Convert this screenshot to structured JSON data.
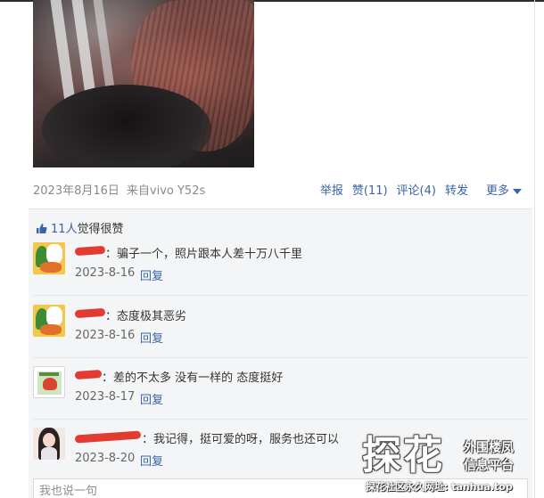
{
  "post": {
    "date": "2023年8月16日",
    "source": "来自vivo Y52s",
    "actions": {
      "report": "举报",
      "like": "赞(11)",
      "comment": "评论(4)",
      "forward": "转发",
      "more": "更多"
    }
  },
  "likes": {
    "count_text": "11人",
    "suffix": "觉得很赞"
  },
  "comments": [
    {
      "text": "：骗子一个，照片跟本人差十万八千里",
      "date": "2023-8-16",
      "reply": "回复"
    },
    {
      "text": "：态度极其恶劣",
      "date": "2023-8-16",
      "reply": "回复"
    },
    {
      "text": "：差的不太多 没有一样的 态度挺好",
      "date": "2023-8-17",
      "reply": "回复"
    },
    {
      "text": "：我记得，挺可爱的呀，服务也还可以",
      "date": "2023-8-20",
      "reply": "回复"
    }
  ],
  "reply_box": {
    "placeholder": "我也说一句"
  },
  "watermark": {
    "big": "探花",
    "line1": "外围楼凤",
    "line2": "信息平台",
    "url": "探花社区永久网址: tanhua.top"
  },
  "colors": {
    "link": "#3b63a5",
    "panel_bg": "#f4f5f7",
    "redaction": "#e23b32"
  }
}
